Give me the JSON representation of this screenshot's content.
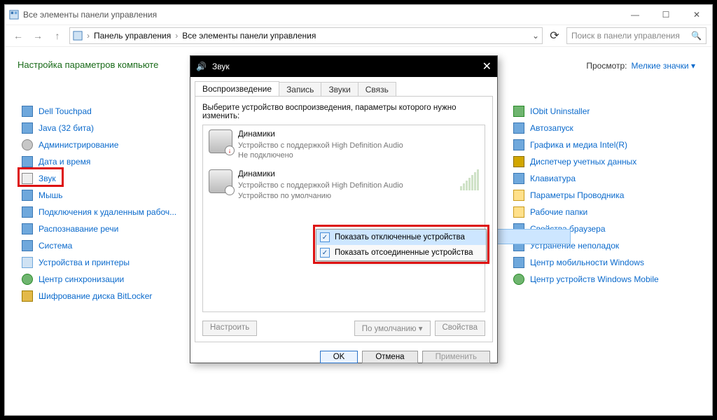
{
  "window": {
    "title": "Все элементы панели управления"
  },
  "address": {
    "seg1": "Панель управления",
    "seg2": "Все элементы панели управления"
  },
  "search": {
    "placeholder": "Поиск в панели управления"
  },
  "heading": "Настройка параметров компьюте",
  "view": {
    "label": "Просмотр:",
    "value": "Мелкие значки"
  },
  "left_items": [
    "Dell Touchpad",
    "Java (32 бита)",
    "Администрирование",
    "Дата и время",
    "Звук",
    "Мышь",
    "Подключения к удаленным рабоч...",
    "Распознавание речи",
    "Система",
    "Устройства и принтеры",
    "Центр синхронизации",
    "Шифрование диска BitLocker"
  ],
  "right_items": [
    "IObit Uninstaller",
    "Автозапуск",
    "Графика и медиа Intel(R)",
    "Диспетчер учетных данных",
    "Клавиатура",
    "Параметры Проводника",
    "Рабочие папки",
    "Свойства браузера",
    "Устранение неполадок",
    "Центр мобильности Windows",
    "Центр устройств Windows Mobile"
  ],
  "sound": {
    "title": "Звук",
    "tabs": [
      "Воспроизведение",
      "Запись",
      "Звуки",
      "Связь"
    ],
    "pane_text": "Выберите устройство воспроизведения, параметры которого нужно изменить:",
    "dev1": {
      "name": "Динамики",
      "line2": "Устройство с поддержкой High Definition Audio",
      "line3": "Не подключено"
    },
    "dev2": {
      "name": "Динамики",
      "line2": "Устройство с поддержкой High Definition Audio",
      "line3": "Устройство по умолчанию"
    },
    "btns": {
      "configure": "Настроить",
      "default": "По умолчанию",
      "props": "Свойства"
    },
    "dlg": {
      "ok": "OK",
      "cancel": "Отмена",
      "apply": "Применить"
    }
  },
  "ctx": {
    "item1": "Показать отключенные устройства",
    "item2": "Показать отсоединенные устройства"
  }
}
